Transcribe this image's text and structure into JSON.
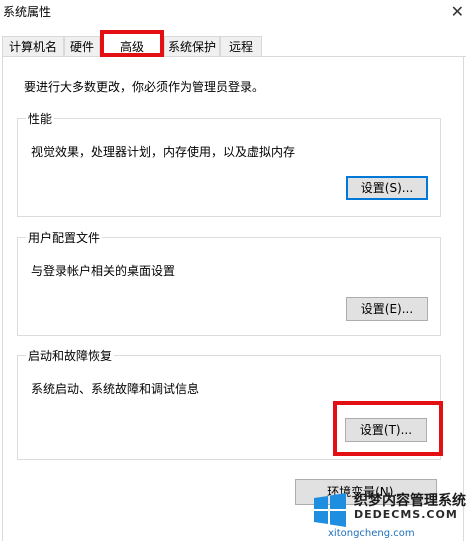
{
  "window": {
    "title": "系统属性"
  },
  "tabs": [
    {
      "label": "计算机名"
    },
    {
      "label": "硬件"
    },
    {
      "label": "高级"
    },
    {
      "label": "系统保护"
    },
    {
      "label": "远程"
    }
  ],
  "intro_text": "要进行大多数更改，你必须作为管理员登录。",
  "groups": {
    "performance": {
      "title": "性能",
      "description": "视觉效果，处理器计划，内存使用，以及虚拟内存",
      "button": "设置(S)..."
    },
    "user_profiles": {
      "title": "用户配置文件",
      "description": "与登录帐户相关的桌面设置",
      "button": "设置(E)..."
    },
    "startup_recovery": {
      "title": "启动和故障恢复",
      "description": "系统启动、系统故障和调试信息",
      "button": "设置(T)..."
    }
  },
  "env_button": "环境变量(N)...",
  "watermark": {
    "line1": "织梦内容管理系统",
    "line2": "DEDECMS.COM",
    "line3": "xitongcheng.com"
  },
  "colors": {
    "highlight": "#e30f13",
    "focus": "#0078d7"
  }
}
